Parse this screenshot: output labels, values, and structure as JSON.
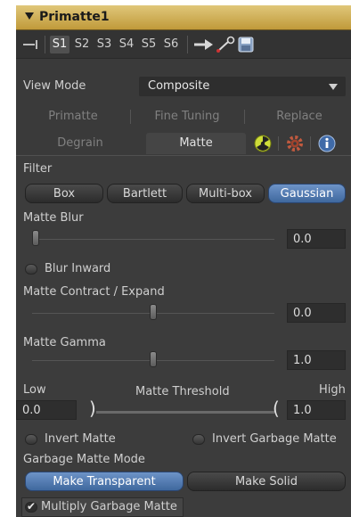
{
  "node": {
    "title": "Primatte1"
  },
  "toolbar": {
    "s1": "S1",
    "s2": "S2",
    "s3": "S3",
    "s4": "S4",
    "s5": "S5",
    "s6": "S6"
  },
  "view_mode": {
    "label": "View Mode",
    "value": "Composite"
  },
  "tabs": {
    "primatte": "Primatte",
    "fine_tuning": "Fine Tuning",
    "replace": "Replace",
    "degrain": "Degrain",
    "matte": "Matte"
  },
  "filter": {
    "label": "Filter",
    "box": "Box",
    "bartlett": "Bartlett",
    "multibox": "Multi-box",
    "gaussian": "Gaussian",
    "selected": "Gaussian"
  },
  "matte_blur": {
    "label": "Matte Blur",
    "value": "0.0",
    "slider_fraction": 0
  },
  "blur_inward": {
    "label": "Blur Inward",
    "checked": false
  },
  "matte_contract": {
    "label": "Matte Contract / Expand",
    "value": "0.0",
    "slider_fraction": 0.5
  },
  "matte_gamma": {
    "label": "Matte Gamma",
    "value": "1.0",
    "slider_fraction": 0.5
  },
  "matte_threshold": {
    "label": "Matte Threshold",
    "low_label": "Low",
    "high_label": "High",
    "low_value": "0.0",
    "high_value": "1.0"
  },
  "invert_matte": {
    "label": "Invert Matte",
    "checked": false
  },
  "invert_garbage_matte": {
    "label": "Invert Garbage Matte",
    "checked": false
  },
  "garbage_mode": {
    "label": "Garbage Matte Mode",
    "make_transparent": "Make Transparent",
    "make_solid": "Make Solid",
    "selected": "Make Transparent"
  },
  "multiply_garbage": {
    "label": "Multiply Garbage Matte",
    "checked": true
  },
  "colors": {
    "title_bar": "#c9a64a",
    "selected_button": "#4f78ad",
    "panel": "#3a3a3a"
  }
}
